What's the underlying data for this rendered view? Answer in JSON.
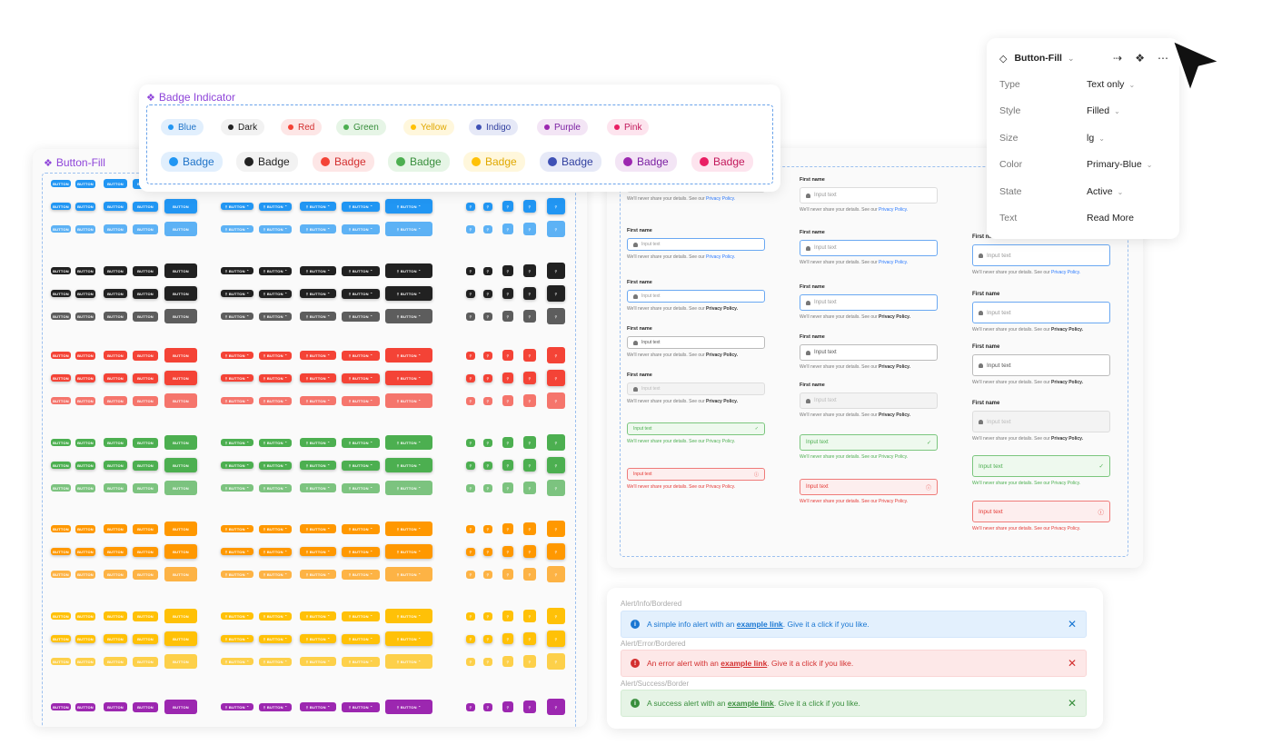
{
  "button_panel": {
    "title": "Button-Fill",
    "button_label": "BUTTON",
    "colors": [
      "#2196f3",
      "#212121",
      "#f44336",
      "#4caf50",
      "#ff9800",
      "#ffc107",
      "#9c27b0"
    ]
  },
  "badge_panel": {
    "title": "Badge Indicator",
    "small": [
      {
        "label": "Blue",
        "bg": "#e1effd",
        "dot": "#2196f3",
        "fg": "#1e73c8"
      },
      {
        "label": "Dark",
        "bg": "#f2f2f2",
        "dot": "#222222",
        "fg": "#222222"
      },
      {
        "label": "Red",
        "bg": "#fde6e6",
        "dot": "#f44336",
        "fg": "#d32f2f"
      },
      {
        "label": "Green",
        "bg": "#e6f5e6",
        "dot": "#4caf50",
        "fg": "#388e3c"
      },
      {
        "label": "Yellow",
        "bg": "#fff7dc",
        "dot": "#ffc107",
        "fg": "#e0a800"
      },
      {
        "label": "Indigo",
        "bg": "#e6e9f7",
        "dot": "#3f51b5",
        "fg": "#303f9f"
      },
      {
        "label": "Purple",
        "bg": "#f3e5f5",
        "dot": "#9c27b0",
        "fg": "#7b1fa2"
      },
      {
        "label": "Pink",
        "bg": "#fde4ee",
        "dot": "#e91e63",
        "fg": "#c2185b"
      }
    ],
    "large_label": "Badge"
  },
  "inputs": {
    "label": "First name",
    "placeholder": "Input text",
    "help_prefix": "We'll never share your details. See our ",
    "help_link": "Privacy Policy."
  },
  "alerts": {
    "info_title": "Alert/Info/Bordered",
    "info_pre": "A simple info alert with an ",
    "info_link": "example link",
    "info_post": ". Give it a click if you like.",
    "error_title": "Alert/Error/Bordered",
    "error_pre": "An error alert with an ",
    "error_link": "example link",
    "error_post": ". Give it a click if you like.",
    "success_title": "Alert/Success/Border",
    "success_pre": "A success alert with an ",
    "success_link": "example link",
    "success_post": ". Give it a click if you like."
  },
  "properties": {
    "component": "Button-Fill",
    "rows": [
      {
        "key": "Type",
        "value": "Text only"
      },
      {
        "key": "Style",
        "value": "Filled"
      },
      {
        "key": "Size",
        "value": "lg"
      },
      {
        "key": "Color",
        "value": "Primary-Blue"
      },
      {
        "key": "State",
        "value": "Active"
      },
      {
        "key": "Text",
        "value": "Read More"
      }
    ]
  }
}
